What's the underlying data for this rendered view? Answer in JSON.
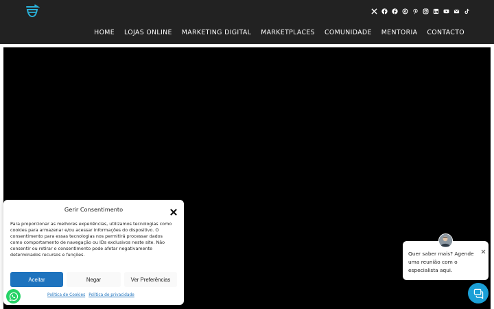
{
  "header": {
    "brand_color": "#2ab1d9",
    "background": "#222222",
    "social_icons": [
      "x-icon",
      "facebook-icon",
      "facebook-alt-icon",
      "threads-icon",
      "pinterest-icon",
      "instagram-icon",
      "linkedin-icon",
      "youtube-icon",
      "email-icon",
      "tiktok-icon"
    ]
  },
  "nav": {
    "items": [
      "HOME",
      "LOJAS ONLINE",
      "MARKETING DIGITAL",
      "MARKETPLACES",
      "COMUNIDADE",
      "MENTORIA",
      "CONTACTO"
    ]
  },
  "consent": {
    "title": "Gerir Consentimento",
    "text": "Para proporcionar as melhores experiências, utilizamos tecnologias como cookies para armazenar e/ou acessar informações do dispositivo. O consentimento para essas tecnologias nos permitirá processar dados como comportamento de navegação ou IDs exclusivos neste site. Não consentir ou retirar o consentimento pode afetar negativamente determinados recursos e funções.",
    "accept_label": "Aceitar",
    "deny_label": "Negar",
    "prefs_label": "Ver Preferências",
    "cookie_policy_label": "Política de Cookies",
    "privacy_policy_label": "Política de privacidade",
    "accent_color": "#1e73be"
  },
  "chat": {
    "message": "Quer saber mais? Agende uma reunião com o especialista aqui.",
    "launcher_color": "#1ba0d7"
  },
  "whatsapp": {
    "color": "#25d366"
  }
}
